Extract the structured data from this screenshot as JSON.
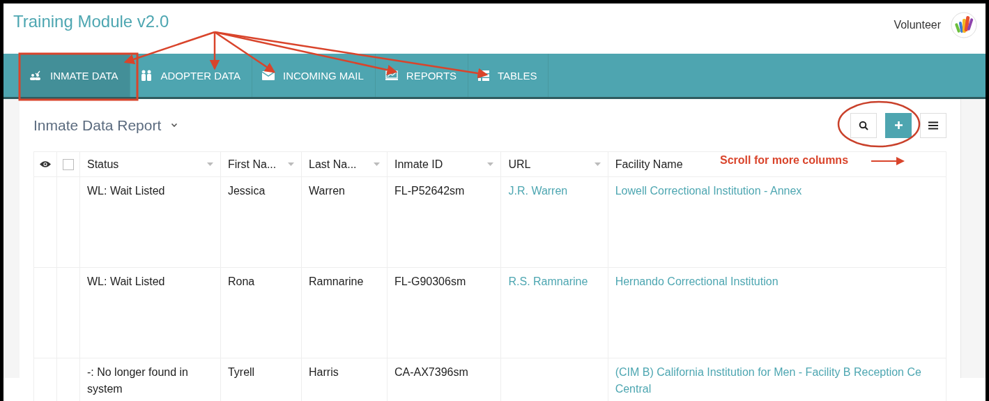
{
  "app_title": "Training Module v2.0",
  "user": {
    "role": "Volunteer"
  },
  "tabs": [
    {
      "label": "INMATE DATA",
      "selected": true
    },
    {
      "label": "ADOPTER DATA",
      "selected": false
    },
    {
      "label": "INCOMING MAIL",
      "selected": false
    },
    {
      "label": "REPORTS",
      "selected": false
    },
    {
      "label": "TABLES",
      "selected": false
    }
  ],
  "report": {
    "title": "Inmate Data Report"
  },
  "select_all": {
    "checked": false
  },
  "columns": [
    {
      "label": "Status",
      "menu": true
    },
    {
      "label": "First Na...",
      "menu": true
    },
    {
      "label": "Last Na...",
      "menu": true
    },
    {
      "label": "Inmate ID",
      "menu": true
    },
    {
      "label": "URL",
      "menu": true
    },
    {
      "label": "Facility Name",
      "menu": false
    }
  ],
  "rows": [
    {
      "status": "WL: Wait Listed",
      "first_name": "Jessica",
      "last_name": "Warren",
      "inmate_id": "FL-P52642sm",
      "url": "J.R. Warren",
      "facility": [
        "Lowell Correctional Institution - Annex"
      ]
    },
    {
      "status": "WL: Wait Listed",
      "first_name": "Rona",
      "last_name": "Ramnarine",
      "inmate_id": "FL-G90306sm",
      "url": "R.S. Ramnarine",
      "facility": [
        "Hernando Correctional Institution"
      ]
    },
    {
      "status": "-: No longer found in system",
      "first_name": "Tyrell",
      "last_name": "Harris",
      "inmate_id": "CA-AX7396sm",
      "facility": [
        "(CIM B) California Institution for Men - Facility B Reception Ce",
        "Central"
      ]
    }
  ],
  "annotation": {
    "note": "Scroll for more columns"
  }
}
